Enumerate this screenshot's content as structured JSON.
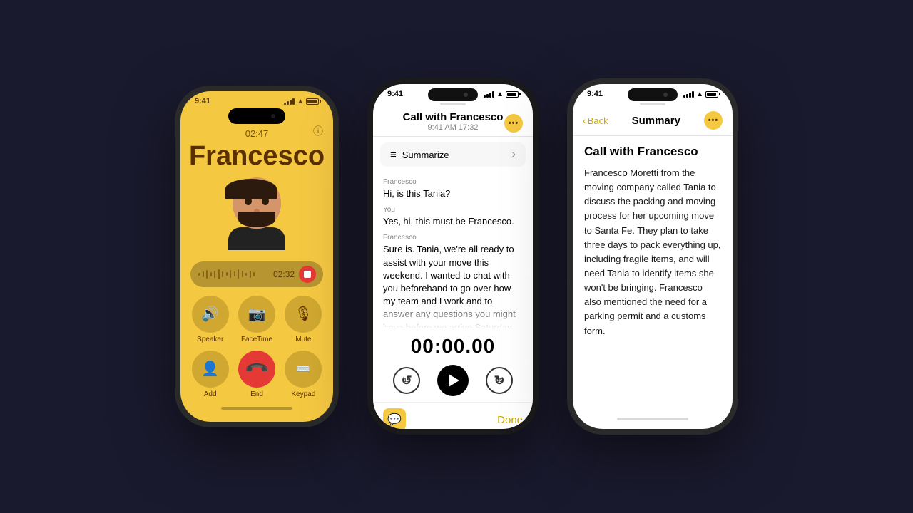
{
  "background": "#1a1a2e",
  "phone1": {
    "status": {
      "time": "9:41",
      "signal": [
        3,
        4,
        5,
        6,
        7
      ],
      "battery": 90
    },
    "info_btn": "ⓘ",
    "call_duration": "02:47",
    "caller_name": "Francesco",
    "recording": {
      "time": "02:32"
    },
    "buttons": [
      {
        "id": "speaker",
        "icon": "🔊",
        "label": "Speaker"
      },
      {
        "id": "facetime",
        "icon": "📷",
        "label": "FaceTime"
      },
      {
        "id": "mute",
        "icon": "🎤",
        "label": "Mute"
      },
      {
        "id": "add",
        "icon": "👤",
        "label": "Add"
      },
      {
        "id": "end",
        "icon": "📞",
        "label": "End",
        "style": "red"
      },
      {
        "id": "keypad",
        "icon": "⌨",
        "label": "Keypad"
      }
    ]
  },
  "phone2": {
    "status": {
      "time": "9:41",
      "signal": [
        3,
        4,
        5,
        6,
        7
      ],
      "battery": 90
    },
    "header": {
      "title": "Call with Francesco",
      "subtitle": "9:41 AM  17:32",
      "more_icon": "···"
    },
    "summarize": {
      "icon": "≡",
      "label": "Summarize",
      "chevron": "›"
    },
    "transcript": [
      {
        "speaker": "Francesco",
        "text": "Hi, is this Tania?"
      },
      {
        "speaker": "You",
        "text": "Yes, hi, this must be Francesco."
      },
      {
        "speaker": "Francesco",
        "text": "Sure is. Tania, we're all ready to assist with your move this weekend. I wanted to chat with you beforehand to go over how my team and I work and to answer any questions you might have before we arrive Saturday"
      }
    ],
    "player": {
      "timer": "00:00.00",
      "skip_back": "15",
      "skip_forward": "15"
    },
    "footer": {
      "done_label": "Done"
    }
  },
  "phone3": {
    "status": {
      "time": "9:41",
      "signal": [
        3,
        4,
        5,
        6,
        7
      ],
      "battery": 90
    },
    "nav": {
      "back_label": "Back",
      "title": "Summary",
      "more_icon": "···"
    },
    "summary": {
      "call_title": "Call with Francesco",
      "body": "Francesco Moretti from the moving company called Tania to discuss the packing and moving process for her upcoming move to Santa Fe. They plan to take three days to pack everything up, including fragile items, and will need Tania to identify items she won't be bringing. Francesco also mentioned the need for a parking permit and a customs form."
    }
  }
}
